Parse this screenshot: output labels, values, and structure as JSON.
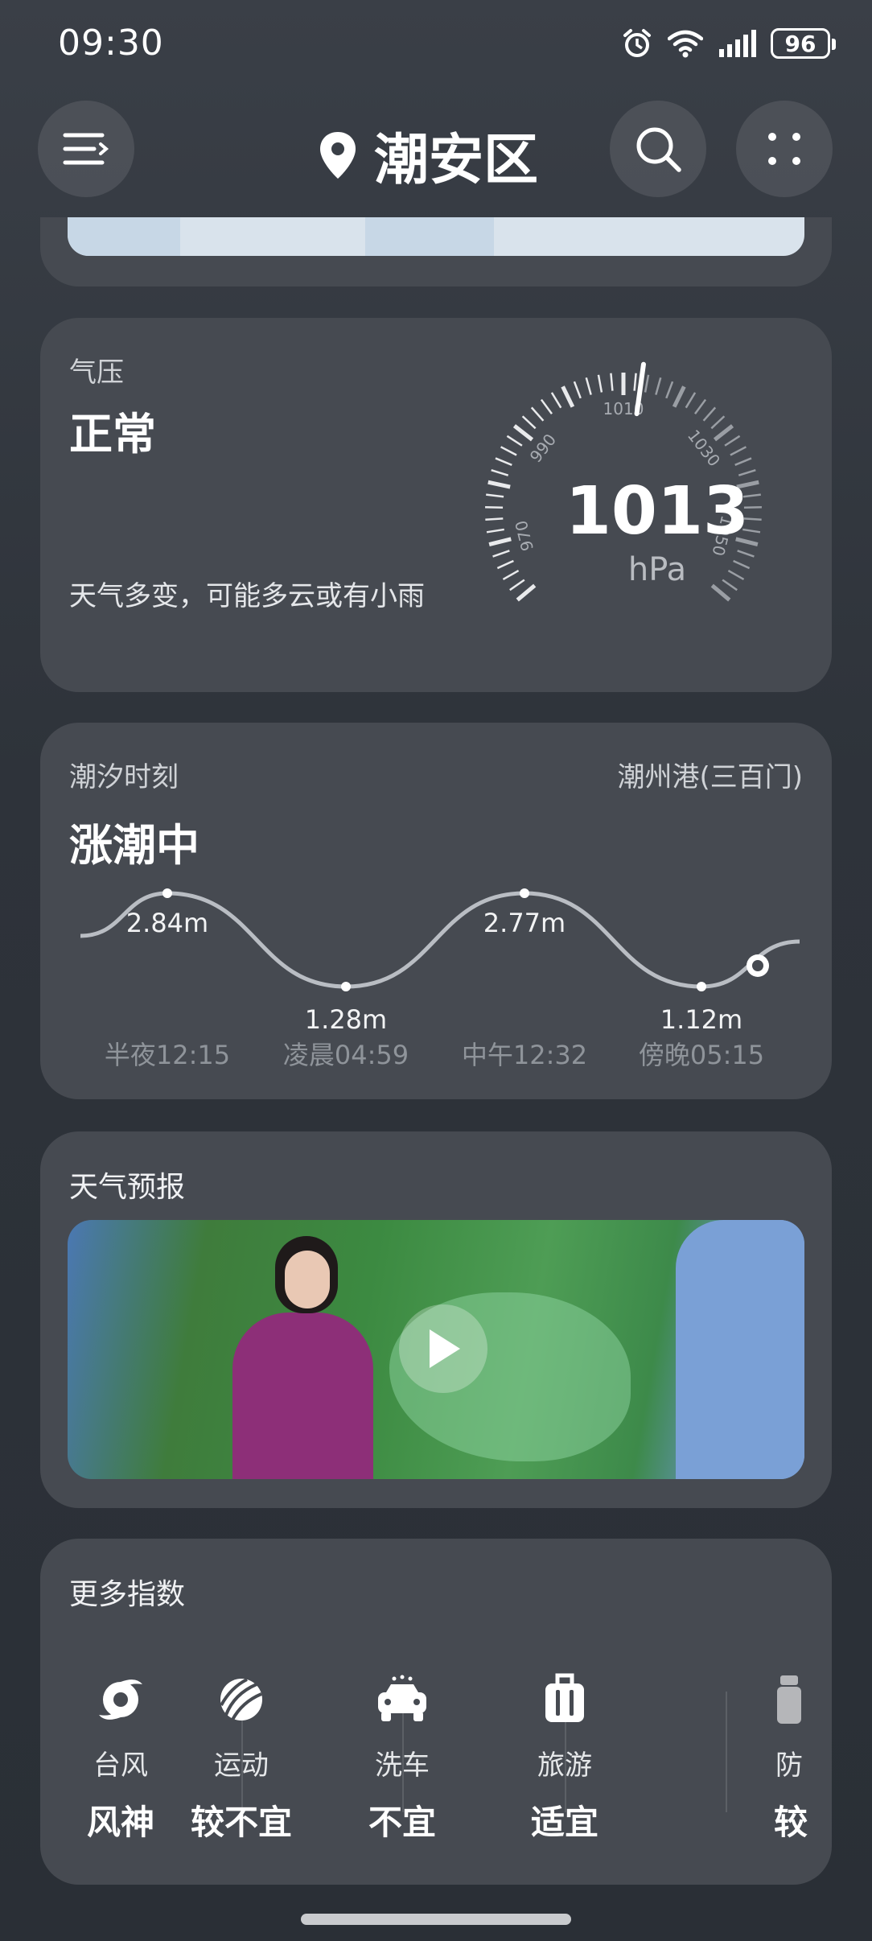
{
  "status_bar": {
    "time": "09:30",
    "battery": "96"
  },
  "header": {
    "location": "潮安区"
  },
  "pressure": {
    "label": "气压",
    "status": "正常",
    "description": "天气多变，可能多云或有小雨",
    "value": "1013",
    "unit": "hPa",
    "gauge_ticks": [
      "970",
      "990",
      "1010",
      "1030",
      "1050"
    ],
    "gauge_value": 1013,
    "gauge_range": [
      960,
      1060
    ]
  },
  "tide": {
    "label": "潮汐时刻",
    "station": "潮州港(三百门)",
    "status": "涨潮中",
    "points": [
      {
        "height": "2.84m",
        "time": "半夜12:15"
      },
      {
        "height": "1.28m",
        "time": "凌晨04:59"
      },
      {
        "height": "2.77m",
        "time": "中午12:32"
      },
      {
        "height": "1.12m",
        "time": "傍晚05:15"
      }
    ]
  },
  "forecast": {
    "label": "天气预报"
  },
  "indices": {
    "label": "更多指数",
    "items": [
      {
        "name": "台风",
        "value": "风神",
        "icon": "typhoon-icon"
      },
      {
        "name": "运动",
        "value": "较不宜",
        "icon": "sport-ball-icon"
      },
      {
        "name": "洗车",
        "value": "不宜",
        "icon": "car-wash-icon"
      },
      {
        "name": "旅游",
        "value": "适宜",
        "icon": "luggage-icon"
      },
      {
        "name": "防",
        "value": "较",
        "icon": "sunscreen-icon"
      }
    ]
  }
}
